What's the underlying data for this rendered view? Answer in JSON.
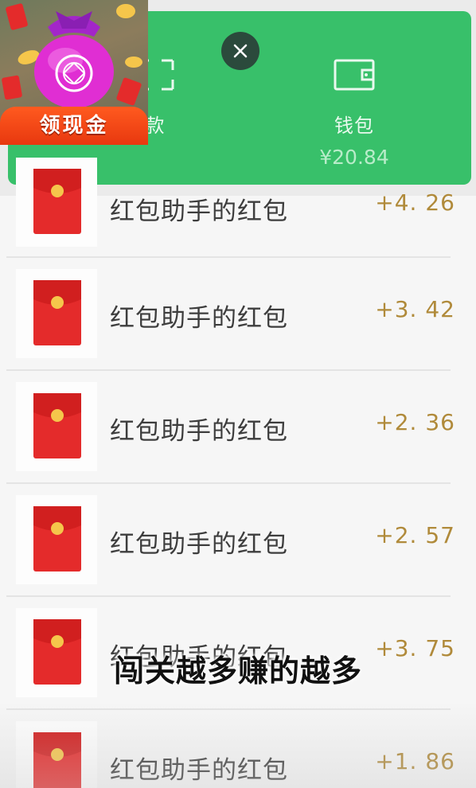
{
  "header": {
    "receive_label": "款",
    "wallet_label": "钱包",
    "wallet_amount": "¥20.84"
  },
  "badge": {
    "label": "领现金"
  },
  "transactions": [
    {
      "title": "红包助手的红包",
      "amount": "+4. 26"
    },
    {
      "title": "红包助手的红包",
      "amount": "+3. 42"
    },
    {
      "title": "红包助手的红包",
      "amount": "+2. 36"
    },
    {
      "title": "红包助手的红包",
      "amount": "+2. 57"
    },
    {
      "title": "红包助手的红包",
      "amount": "+3. 75"
    },
    {
      "title": "红包助手的红包",
      "amount": "+1. 86"
    }
  ],
  "subtitle": "闯关越多赚的越多",
  "colors": {
    "panel_green": "#38c06a",
    "envelope_red": "#e42b2b",
    "coin_gold": "#f5c64b",
    "amount_gold": "#b08a3a"
  },
  "icons": {
    "close": "close-icon",
    "wallet": "wallet-icon",
    "receive": "qr-receive-icon",
    "envelope": "red-envelope-icon",
    "badge": "lucky-bag-icon"
  }
}
